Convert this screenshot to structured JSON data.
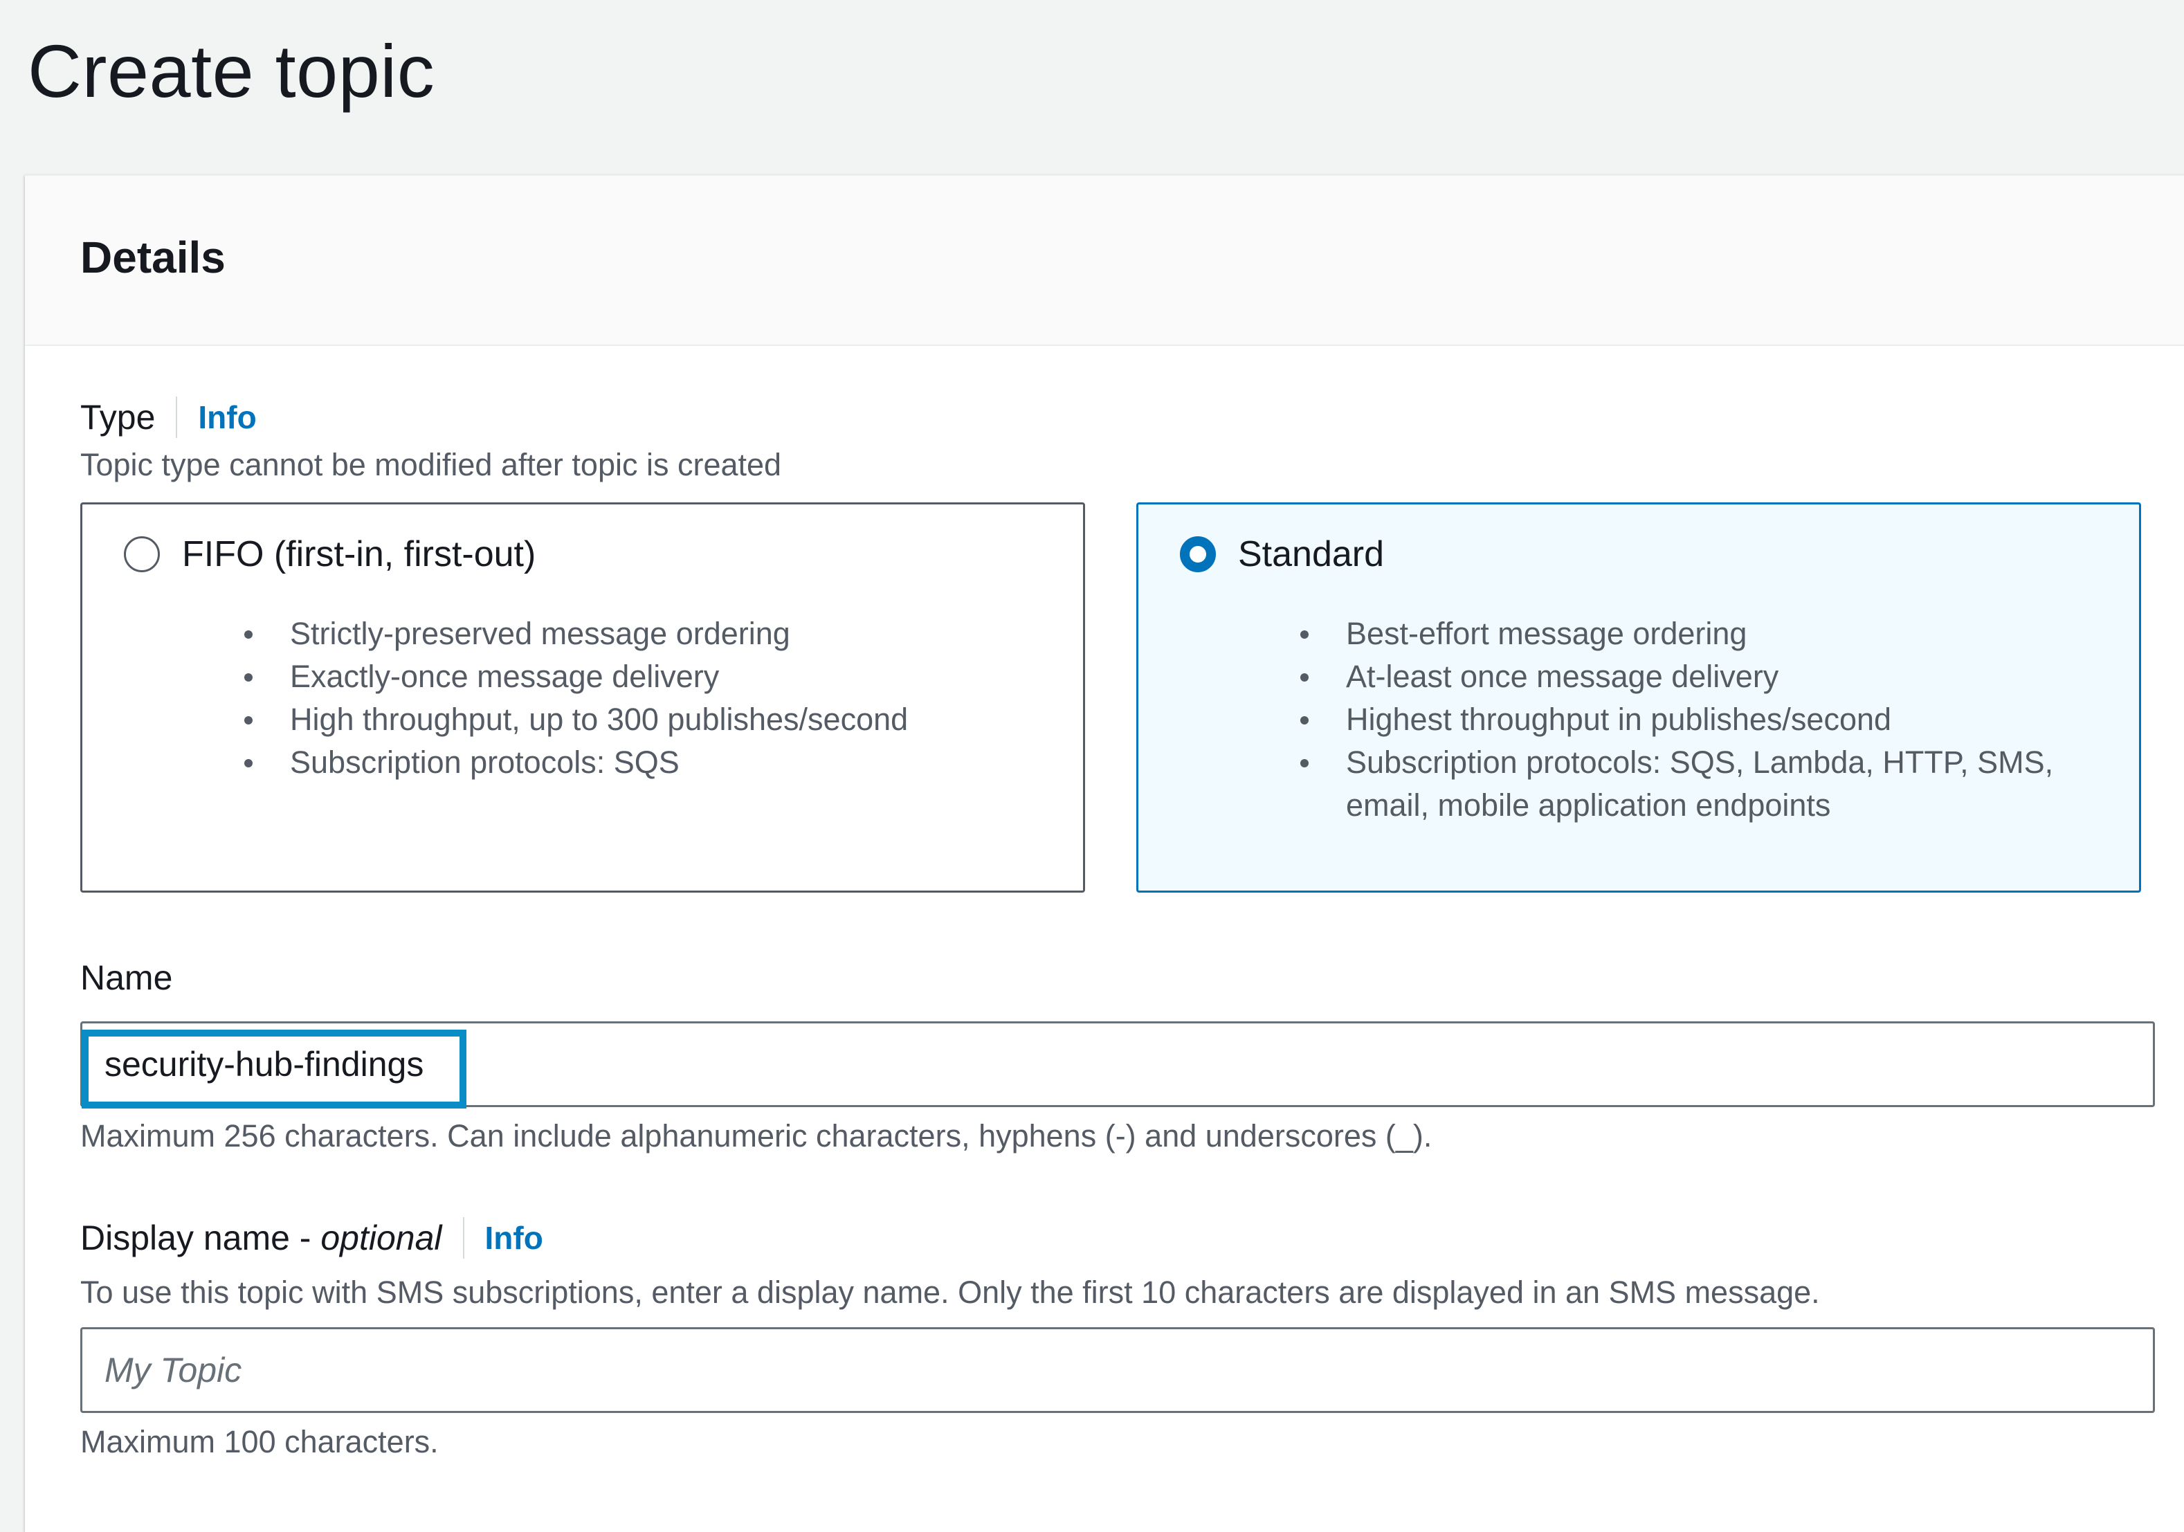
{
  "page": {
    "title": "Create topic"
  },
  "details": {
    "title": "Details",
    "type": {
      "label": "Type",
      "info": "Info",
      "description": "Topic type cannot be modified after topic is created",
      "options": [
        {
          "title": "FIFO (first-in, first-out)",
          "selected": false,
          "bullets": [
            "Strictly-preserved message ordering",
            "Exactly-once message delivery",
            "High throughput, up to 300 publishes/second",
            "Subscription protocols: SQS"
          ]
        },
        {
          "title": "Standard",
          "selected": true,
          "bullets": [
            "Best-effort message ordering",
            "At-least once message delivery",
            "Highest throughput in publishes/second",
            "Subscription protocols: SQS, Lambda, HTTP, SMS, email, mobile application endpoints"
          ]
        }
      ]
    },
    "name": {
      "label": "Name",
      "value": "security-hub-findings",
      "constraint": "Maximum 256 characters. Can include alphanumeric characters, hyphens (-) and underscores (_)."
    },
    "display_name": {
      "label": "Display name - ",
      "optional": "optional",
      "info": "Info",
      "description": "To use this topic with SMS subscriptions, enter a display name. Only the first 10 characters are displayed in an SMS message.",
      "placeholder": "My Topic",
      "constraint": "Maximum 100 characters."
    }
  },
  "colors": {
    "accent": "#0073bb",
    "selected_tile_bg": "#f1faff",
    "highlight": "#0a8cc7",
    "page_bg": "#f2f3f3"
  }
}
